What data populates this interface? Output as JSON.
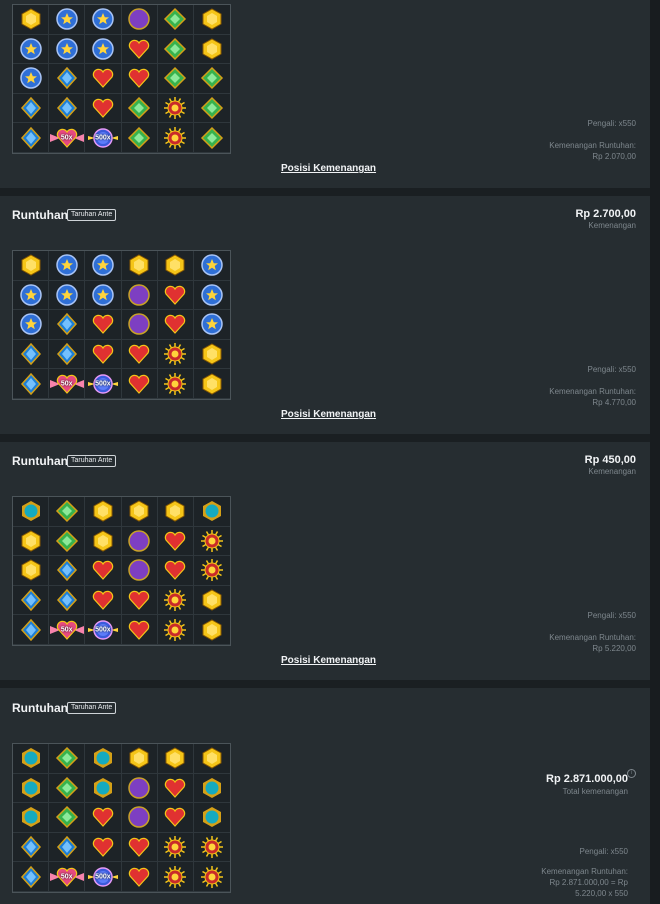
{
  "sections": [
    {
      "pengali": "Pengali: x550",
      "cascade_label": "Kemenangan Runtuhan:",
      "cascade_value": "Rp 2.070,00",
      "link": "Posisi Kemenangan",
      "grid": [
        [
          "yellow",
          "star",
          "star",
          "moon",
          "green",
          "yellow"
        ],
        [
          "star",
          "star",
          "star",
          "heart",
          "green",
          "yellow"
        ],
        [
          "star",
          "blue",
          "heart",
          "heart",
          "green",
          "green"
        ],
        [
          "blue",
          "blue",
          "heart",
          "green",
          "sun",
          "green"
        ],
        [
          "blue",
          "heart50",
          "orb500",
          "green",
          "sun",
          "green"
        ]
      ],
      "mult_labels": {
        "heart50": "50x",
        "orb500": "500x"
      }
    },
    {
      "title": "Runtuhan",
      "badge": "Taruhan Ante",
      "amount": "Rp 2.700,00",
      "amount_label": "Kemenangan",
      "pengali": "Pengali: x550",
      "cascade_label": "Kemenangan Runtuhan:",
      "cascade_value": "Rp 4.770,00",
      "link": "Posisi Kemenangan",
      "grid": [
        [
          "yellow",
          "star",
          "star",
          "yellow",
          "yellow",
          "star"
        ],
        [
          "star",
          "star",
          "star",
          "moon",
          "heart",
          "star"
        ],
        [
          "star",
          "blue",
          "heart",
          "moon",
          "heart",
          "star"
        ],
        [
          "blue",
          "blue",
          "heart",
          "heart",
          "sun",
          "yellow"
        ],
        [
          "blue",
          "heart50",
          "orb500",
          "heart",
          "sun",
          "yellow"
        ]
      ],
      "mult_labels": {
        "heart50": "50x",
        "orb500": "500x"
      }
    },
    {
      "title": "Runtuhan",
      "badge": "Taruhan Ante",
      "amount": "Rp 450,00",
      "amount_label": "Kemenangan",
      "pengali": "Pengali: x550",
      "cascade_label": "Kemenangan Runtuhan:",
      "cascade_value": "Rp 5.220,00",
      "link": "Posisi Kemenangan",
      "grid": [
        [
          "cyan",
          "green",
          "yellow",
          "yellow",
          "yellow",
          "cyan"
        ],
        [
          "yellow",
          "green",
          "yellow",
          "moon",
          "heart",
          "sun"
        ],
        [
          "yellow",
          "blue",
          "heart",
          "moon",
          "heart",
          "sun"
        ],
        [
          "blue",
          "blue",
          "heart",
          "heart",
          "sun",
          "yellow"
        ],
        [
          "blue",
          "heart50",
          "orb500",
          "heart",
          "sun",
          "yellow"
        ]
      ],
      "mult_labels": {
        "heart50": "50x",
        "orb500": "500x"
      }
    },
    {
      "title": "Runtuhan",
      "badge": "Taruhan Ante",
      "amount": "Rp 2.871.000,00",
      "amount_label": "Total kemenangan",
      "pengali": "Pengali: x550",
      "cascade_label": "Kemenangan Runtuhan:",
      "cascade_value": "Rp 2.871.000,00 = Rp",
      "cascade_value2": "5.220,00 x 550",
      "grid": [
        [
          "cyan",
          "green",
          "cyan",
          "yellow",
          "yellow",
          "yellow"
        ],
        [
          "cyan",
          "green",
          "cyan",
          "moon",
          "heart",
          "cyan"
        ],
        [
          "cyan",
          "green",
          "heart",
          "moon",
          "heart",
          "cyan"
        ],
        [
          "blue",
          "blue",
          "heart",
          "heart",
          "sun",
          "sun"
        ],
        [
          "blue",
          "heart50",
          "orb500",
          "heart",
          "sun",
          "sun"
        ]
      ],
      "mult_labels": {
        "heart50": "50x",
        "orb500": "500x"
      }
    }
  ],
  "gem_colors": {
    "yellow": "#f5c518",
    "star": "#2f6fd6",
    "moon": "#7d3fc2",
    "green": "#37b24d",
    "heart": "#e03131",
    "blue": "#1c7ed6",
    "sun": "#e8590c",
    "cyan": "#15aabf",
    "heart50": "#e64980",
    "orb500": "#3b5bdb"
  }
}
